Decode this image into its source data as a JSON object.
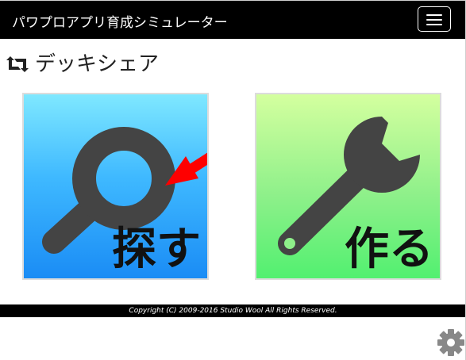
{
  "navbar": {
    "brand": "パワプロアプリ育成シミュレーター",
    "menu_icon": "hamburger-icon"
  },
  "page": {
    "title": "デッキシェア",
    "title_icon": "retweet-icon"
  },
  "tiles": [
    {
      "label": "探す",
      "icon": "magnifier-icon",
      "arrow_color": "#ff0000"
    },
    {
      "label": "作る",
      "icon": "wrench-icon"
    }
  ],
  "footer": {
    "copyright": "Copyright (C) 2009-2016 Studio Wool All Rights Reserved."
  },
  "settings_icon": "gear-icon",
  "colors": {
    "navbar": "#000000",
    "search_tile_top": "#7fe8ff",
    "search_tile_bottom": "#1a8cf5",
    "make_tile_top": "#d4ff9f",
    "make_tile_bottom": "#52f070",
    "icon_gray": "#444444",
    "arrow_red": "#ff0000"
  }
}
